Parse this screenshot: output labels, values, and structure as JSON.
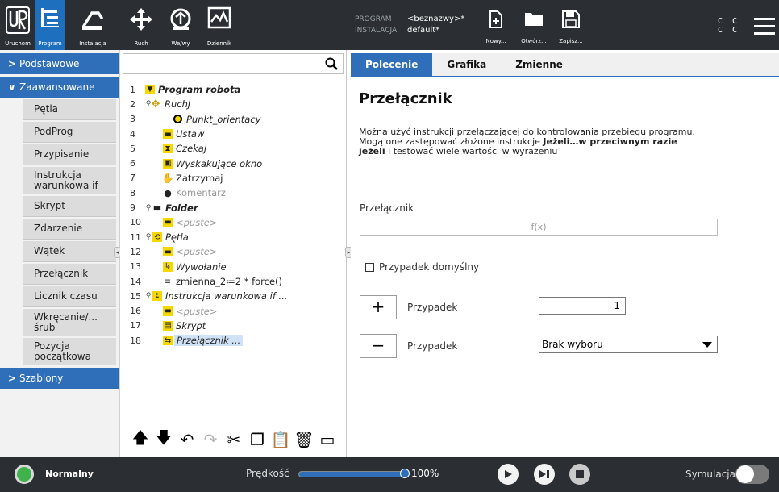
{
  "topbar": {
    "nav": [
      {
        "label": "Uruchom",
        "icon": "ur-logo-icon"
      },
      {
        "label": "Program",
        "icon": "program-tree-icon"
      },
      {
        "label": "Instalacja",
        "icon": "robot-arm-icon"
      },
      {
        "label": "Ruch",
        "icon": "move-arrows-icon"
      },
      {
        "label": "We/wy",
        "icon": "io-icon"
      },
      {
        "label": "Dziennik",
        "icon": "log-chart-icon"
      }
    ],
    "program_key": "PROGRAM",
    "program_value": "<beznazwy>*",
    "installation_key": "INSTALACJA",
    "installation_value": "default*",
    "file_buttons": {
      "new": "Nowy...",
      "open": "Otwórz...",
      "save": "Zapisz..."
    },
    "cc_line1": "C C",
    "cc_line2": "C C"
  },
  "left": {
    "cat_basic": "Podstawowe",
    "cat_advanced": "Zaawansowane",
    "cat_templates": "Szablony",
    "items": [
      "Pętla",
      "PodProg",
      "Przypisanie",
      "Instrukcja warunkowa if",
      "Skrypt",
      "Zdarzenie",
      "Wątek",
      "Przełącznik",
      "Licznik czasu",
      "Wkręcanie/... śrub",
      "Pozycja początkowa"
    ]
  },
  "tree": {
    "rows": [
      {
        "n": "1",
        "t": "Program robota"
      },
      {
        "n": "2",
        "t": "RuchJ"
      },
      {
        "n": "3",
        "t": "Punkt_orientacy"
      },
      {
        "n": "4",
        "t": "Ustaw"
      },
      {
        "n": "5",
        "t": "Czekaj"
      },
      {
        "n": "6",
        "t": "Wyskakujące okno"
      },
      {
        "n": "7",
        "t": "Zatrzymaj"
      },
      {
        "n": "8",
        "t": "Komentarz"
      },
      {
        "n": "9",
        "t": "Folder"
      },
      {
        "n": "10",
        "t": "<puste>"
      },
      {
        "n": "11",
        "t": "Pętla"
      },
      {
        "n": "12",
        "t": "<puste>"
      },
      {
        "n": "13",
        "t": "Wywołanie"
      },
      {
        "n": "14",
        "t": "zmienna_2≔2 * force()"
      },
      {
        "n": "15",
        "t": "Instrukcja warunkowa if ..."
      },
      {
        "n": "16",
        "t": "<puste>"
      },
      {
        "n": "17",
        "t": "Skrypt"
      },
      {
        "n": "18",
        "t": "Przełącznik ..."
      }
    ]
  },
  "right": {
    "tabs": [
      "Polecenie",
      "Grafika",
      "Zmienne"
    ],
    "title": "Przełącznik",
    "desc_part1": "Można użyć instrukcji przełączającej do kontrolowania przebiegu programu. Mogą one zastępować złożone instrukcje ",
    "desc_bold": "Jeżeli…w przeciwnym razie jeżeli",
    "desc_part2": " i testować wiele wartości w wyrażeniu",
    "switch_label": "Przełącznik",
    "expr_placeholder": "f(x)",
    "default_case_label": "Przypadek domyślny",
    "case_label": "Przypadek",
    "case_number": "1",
    "remove_select": "Brak wyboru"
  },
  "bottom": {
    "status": "Normalny",
    "speed_label": "Prędkość",
    "speed_pct": "100%",
    "speed_value": 1.0,
    "sim_label": "Symulacja"
  },
  "colors": {
    "accent": "#2f6fba",
    "bar": "#2b2f33",
    "status_ok": "#3fb24b"
  }
}
